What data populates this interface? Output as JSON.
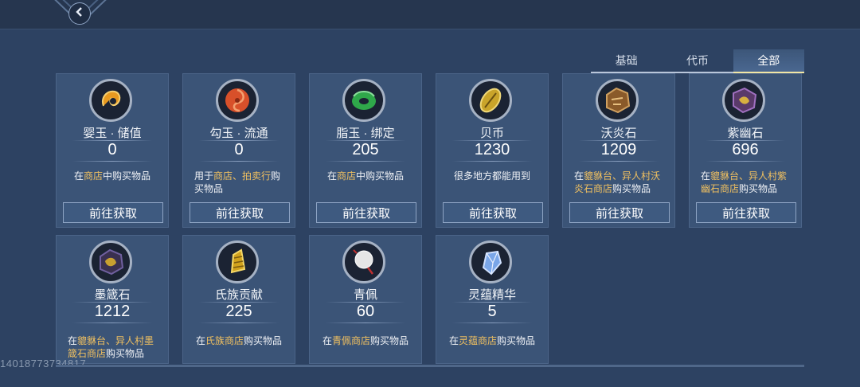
{
  "header": {
    "back_label": "back"
  },
  "tabs": [
    {
      "label": "基础",
      "active": false
    },
    {
      "label": "代币",
      "active": false
    },
    {
      "label": "全部",
      "active": true
    }
  ],
  "get_button_label": "前往获取",
  "items": [
    {
      "name": "婴玉 · 储值",
      "count": "0",
      "icon": "orange-jade-icon",
      "color": "#e89a20",
      "desc": [
        {
          "t": "在"
        },
        {
          "t": "商店",
          "hl": true
        },
        {
          "t": "中购买物品"
        }
      ],
      "center": true,
      "button": true
    },
    {
      "name": "勾玉 · 流通",
      "count": "0",
      "icon": "red-swirl-jade-icon",
      "color": "#d8502a",
      "desc": [
        {
          "t": "用于"
        },
        {
          "t": "商店、拍卖行",
          "hl": true
        },
        {
          "t": "购买物品"
        }
      ],
      "center": false,
      "button": true
    },
    {
      "name": "脂玉 · 绑定",
      "count": "205",
      "icon": "green-jade-icon",
      "color": "#2fa84a",
      "desc": [
        {
          "t": "在"
        },
        {
          "t": "商店",
          "hl": true
        },
        {
          "t": "中购买物品"
        }
      ],
      "center": true,
      "button": true
    },
    {
      "name": "贝币",
      "count": "1230",
      "icon": "gold-shell-icon",
      "color": "#c9a42a",
      "desc": [
        {
          "t": "很多地方都能用到"
        }
      ],
      "center": true,
      "button": true
    },
    {
      "name": "沃炎石",
      "count": "1209",
      "icon": "bronze-stone-icon",
      "color": "#8a5a2a",
      "desc": [
        {
          "t": "在"
        },
        {
          "t": "貔貅台、异人村沃炎石商店",
          "hl": true
        },
        {
          "t": "购买物品"
        }
      ],
      "center": false,
      "button": true
    },
    {
      "name": "紫幽石",
      "count": "696",
      "icon": "purple-stone-icon",
      "color": "#5a3a6a",
      "desc": [
        {
          "t": "在"
        },
        {
          "t": "貔貅台、异人村紫幽石商店",
          "hl": true
        },
        {
          "t": "购买物品"
        }
      ],
      "center": false,
      "button": true
    },
    {
      "name": "墨箴石",
      "count": "1212",
      "icon": "dark-stone-icon",
      "color": "#3a3050",
      "desc": [
        {
          "t": "在"
        },
        {
          "t": "貔貅台、异人村墨箴石商店",
          "hl": true
        },
        {
          "t": "购买物品"
        }
      ],
      "center": false,
      "button": false
    },
    {
      "name": "氏族贡献",
      "count": "225",
      "icon": "gold-bell-icon",
      "color": "#d1a21c",
      "desc": [
        {
          "t": "在"
        },
        {
          "t": "氏族商店",
          "hl": true
        },
        {
          "t": "购买物品"
        }
      ],
      "center": true,
      "button": false
    },
    {
      "name": "青佩",
      "count": "60",
      "icon": "white-pendant-icon",
      "color": "#e6e6e6",
      "desc": [
        {
          "t": "在"
        },
        {
          "t": "青佩商店",
          "hl": true
        },
        {
          "t": "购买物品"
        }
      ],
      "center": true,
      "button": false
    },
    {
      "name": "灵蕴精华",
      "count": "5",
      "icon": "blue-crystal-icon",
      "color": "#7aa6e8",
      "desc": [
        {
          "t": "在"
        },
        {
          "t": "灵蕴商店",
          "hl": true
        },
        {
          "t": "购买物品"
        }
      ],
      "center": true,
      "button": false
    }
  ],
  "footer": {
    "uid": "14018773734817"
  }
}
